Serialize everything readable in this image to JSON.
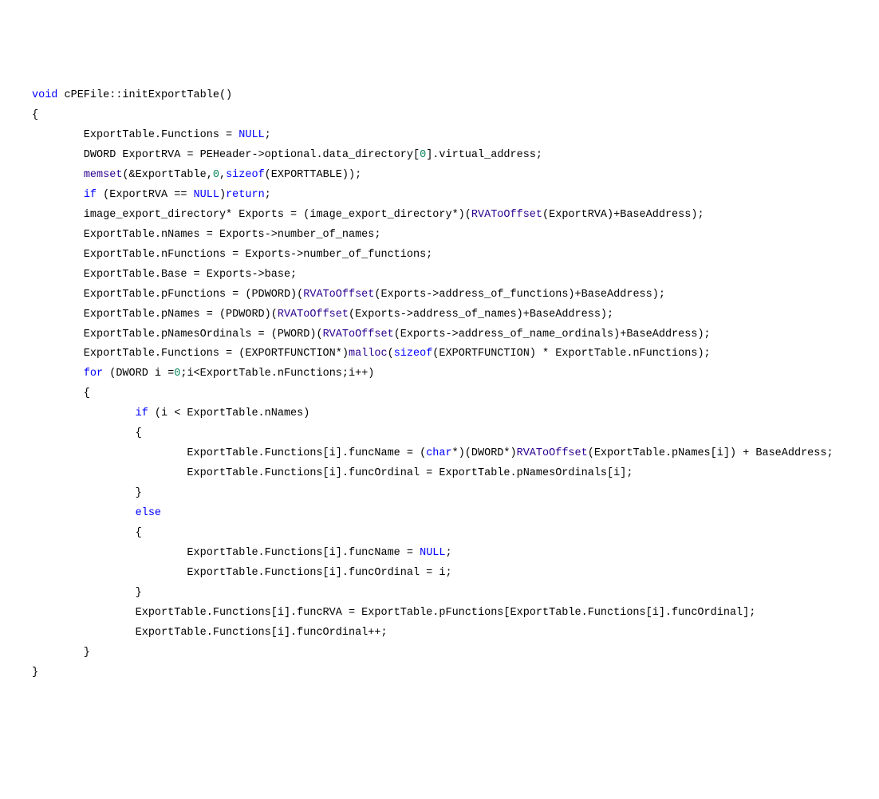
{
  "code": {
    "tokens": [
      [
        {
          "t": "void",
          "c": "kw"
        },
        {
          "t": " cPEFile::initExportTable()"
        }
      ],
      [
        {
          "t": "{"
        }
      ],
      [
        {
          "t": "        ExportTable.Functions = "
        },
        {
          "t": "NULL",
          "c": "null"
        },
        {
          "t": ";"
        }
      ],
      [
        {
          "t": "        DWORD ExportRVA = PEHeader->optional.data_directory["
        },
        {
          "t": "0",
          "c": "num"
        },
        {
          "t": "].virtual_address;"
        }
      ],
      [
        {
          "t": "        "
        },
        {
          "t": "memset",
          "c": "fn"
        },
        {
          "t": "(&ExportTable,"
        },
        {
          "t": "0",
          "c": "num"
        },
        {
          "t": ","
        },
        {
          "t": "sizeof",
          "c": "kw"
        },
        {
          "t": "(EXPORTTABLE));"
        }
      ],
      [
        {
          "t": "        "
        },
        {
          "t": "if",
          "c": "kw"
        },
        {
          "t": " (ExportRVA == "
        },
        {
          "t": "NULL",
          "c": "null"
        },
        {
          "t": ")"
        },
        {
          "t": "return",
          "c": "kw"
        },
        {
          "t": ";"
        }
      ],
      [
        {
          "t": "        image_export_directory* Exports = (image_export_directory*)("
        },
        {
          "t": "RVAToOffset",
          "c": "fn"
        },
        {
          "t": "(ExportRVA)+BaseAddress);"
        }
      ],
      [
        {
          "t": ""
        }
      ],
      [
        {
          "t": "        ExportTable.nNames = Exports->number_of_names;"
        }
      ],
      [
        {
          "t": "        ExportTable.nFunctions = Exports->number_of_functions;"
        }
      ],
      [
        {
          "t": "        ExportTable.Base = Exports->base;"
        }
      ],
      [
        {
          "t": "        ExportTable.pFunctions = (PDWORD)("
        },
        {
          "t": "RVAToOffset",
          "c": "fn"
        },
        {
          "t": "(Exports->address_of_functions)+BaseAddress);"
        }
      ],
      [
        {
          "t": "        ExportTable.pNames = (PDWORD)("
        },
        {
          "t": "RVAToOffset",
          "c": "fn"
        },
        {
          "t": "(Exports->address_of_names)+BaseAddress);"
        }
      ],
      [
        {
          "t": "        ExportTable.pNamesOrdinals = (PWORD)("
        },
        {
          "t": "RVAToOffset",
          "c": "fn"
        },
        {
          "t": "(Exports->address_of_name_ordinals)+BaseAddress);"
        }
      ],
      [
        {
          "t": ""
        }
      ],
      [
        {
          "t": "        ExportTable.Functions = (EXPORTFUNCTION*)"
        },
        {
          "t": "malloc",
          "c": "fn"
        },
        {
          "t": "("
        },
        {
          "t": "sizeof",
          "c": "kw"
        },
        {
          "t": "(EXPORTFUNCTION) * ExportTable.nFunctions);"
        }
      ],
      [
        {
          "t": ""
        }
      ],
      [
        {
          "t": "        "
        },
        {
          "t": "for",
          "c": "kw"
        },
        {
          "t": " (DWORD i ="
        },
        {
          "t": "0",
          "c": "num"
        },
        {
          "t": ";i<ExportTable.nFunctions;i++)"
        }
      ],
      [
        {
          "t": "        {"
        }
      ],
      [
        {
          "t": "                "
        },
        {
          "t": "if",
          "c": "kw"
        },
        {
          "t": " (i < ExportTable.nNames)"
        }
      ],
      [
        {
          "t": "                {"
        }
      ],
      [
        {
          "t": "                        ExportTable.Functions[i].funcName = ("
        },
        {
          "t": "char",
          "c": "kw"
        },
        {
          "t": "*)(DWORD*)"
        },
        {
          "t": "RVAToOffset",
          "c": "fn"
        },
        {
          "t": "(ExportTable.pNames[i]) + BaseAddress;"
        }
      ],
      [
        {
          "t": "                        ExportTable.Functions[i].funcOrdinal = ExportTable.pNamesOrdinals[i];"
        }
      ],
      [
        {
          "t": "                }"
        }
      ],
      [
        {
          "t": "                "
        },
        {
          "t": "else",
          "c": "kw"
        }
      ],
      [
        {
          "t": "                {"
        }
      ],
      [
        {
          "t": "                        ExportTable.Functions[i].funcName = "
        },
        {
          "t": "NULL",
          "c": "null"
        },
        {
          "t": ";"
        }
      ],
      [
        {
          "t": "                        ExportTable.Functions[i].funcOrdinal = i;"
        }
      ],
      [
        {
          "t": "                }"
        }
      ],
      [
        {
          "t": "                ExportTable.Functions[i].funcRVA = ExportTable.pFunctions[ExportTable.Functions[i].funcOrdinal];"
        }
      ],
      [
        {
          "t": "                ExportTable.Functions[i].funcOrdinal++;"
        }
      ],
      [
        {
          "t": "        }"
        }
      ],
      [
        {
          "t": "}"
        }
      ]
    ]
  }
}
